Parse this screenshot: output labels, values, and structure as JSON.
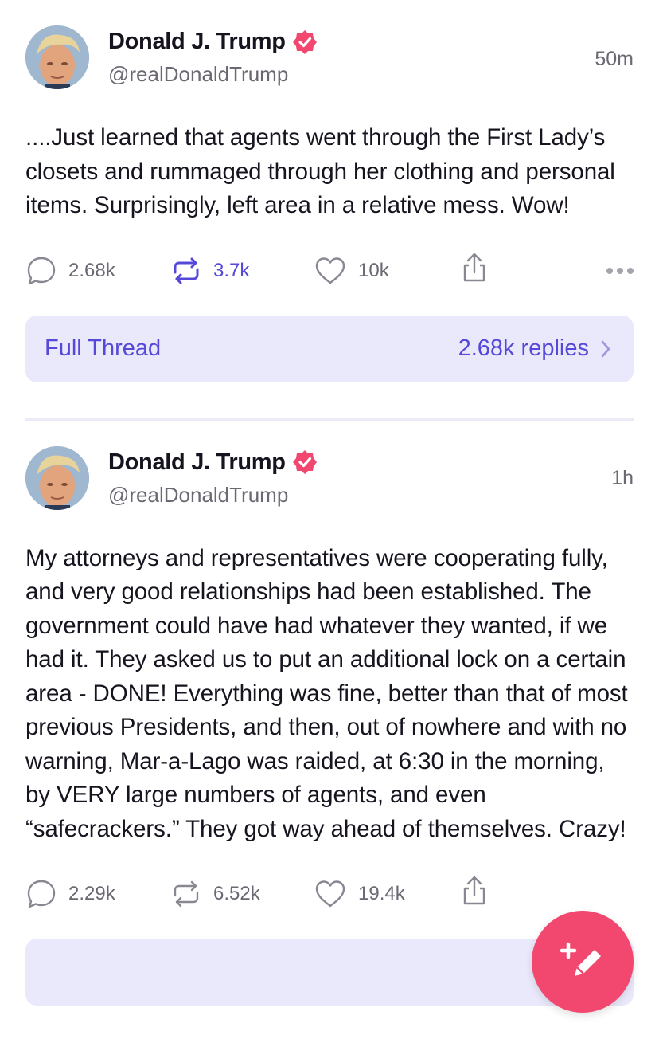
{
  "posts": [
    {
      "author_name": "Donald J. Trump",
      "handle": "@realDonaldTrump",
      "time": "50m",
      "text": "....Just learned that agents went through the First Lady’s closets and rummaged through her clothing and personal items. Surprisingly, left area in a relative mess. Wow!",
      "replies": "2.68k",
      "reposts": "3.7k",
      "likes": "10k",
      "reposted_by_viewer": true,
      "thread_label": "Full Thread",
      "thread_replies": "2.68k replies"
    },
    {
      "author_name": "Donald J. Trump",
      "handle": "@realDonaldTrump",
      "time": "1h",
      "text": "My attorneys and representatives were cooperating fully, and very good relationships had been established. The government could have had whatever they wanted, if we had it. They asked us to put an additional lock on a certain area - DONE! Everything was fine, better than that of most previous Presidents, and then, out of nowhere and with no warning, Mar-a-Lago was raided, at 6:30 in the morning, by VERY large numbers of agents, and even “safecrackers.” They got way ahead of themselves. Crazy!",
      "replies": "2.29k",
      "reposts": "6.52k",
      "likes": "19.4k",
      "reposted_by_viewer": false
    }
  ],
  "icons": {
    "verified": "verified-badge-icon",
    "reply": "speech-bubble-icon",
    "repost": "repost-arrows-icon",
    "like": "heart-icon",
    "share": "share-icon",
    "more": "more-dots-icon",
    "compose": "compose-pencil-icon"
  },
  "colors": {
    "accent": "#5648d8",
    "verified": "#f2476f",
    "fab": "#f2476f",
    "thread_bar": "#eae9fb",
    "muted_text": "#6b6873"
  }
}
